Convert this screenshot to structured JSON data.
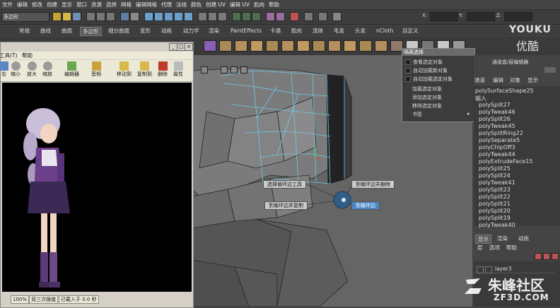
{
  "menubar": {
    "items": [
      "文件",
      "编辑",
      "修改",
      "创建",
      "显示",
      "窗口",
      "资源",
      "选择",
      "网格",
      "编辑网格",
      "代理",
      "法线",
      "颜色",
      "创建 UV",
      "编辑 UV",
      "肌肉",
      "帮助"
    ]
  },
  "statusline": {
    "mode": "多边形",
    "x_label": "X:",
    "y_label": "Y:",
    "z_label": "Z:"
  },
  "shelf": {
    "tabs": [
      "常规",
      "曲线",
      "曲面",
      "多边形",
      "细分曲面",
      "变形",
      "动画",
      "动力学",
      "渲染",
      "PaintEffects",
      "卡通",
      "肌肉",
      "流体",
      "毛发",
      "头发",
      "nCloth",
      "自定义"
    ],
    "active": "多边形"
  },
  "watermark": {
    "youku": "YOUKU",
    "youku_cn": "优酷",
    "site_cn": "朱峰社区",
    "site_en": "ZF3D.COM"
  },
  "leftwin": {
    "title": "工具(T)",
    "menu": [
      "工具(T)",
      "帮助"
    ],
    "tools": [
      "右",
      "缩小",
      "放大",
      "缩放",
      "编辑器",
      "音频",
      "移动到",
      "复制到",
      "删除",
      "属性"
    ],
    "status": [
      "100%",
      "双三次插值",
      "已载入于 0.0 秒"
    ]
  },
  "popup": {
    "title": "隔离选择",
    "items": [
      {
        "label": "查看选定对象",
        "checkbox": true
      },
      {
        "label": "自动加载新对象",
        "checkbox": true
      },
      {
        "label": "自动加载选定对象",
        "checkbox": true
      },
      {
        "label": "加载选定对象",
        "checkbox": false
      },
      {
        "label": "添加选定对象",
        "checkbox": false
      },
      {
        "label": "移除选定对象",
        "checkbox": false
      },
      {
        "label": "书签",
        "checkbox": false,
        "submenu": true
      }
    ]
  },
  "marking_menu": {
    "n": "选择循环边工具",
    "ne": "到循环边并删除",
    "sw": "到循环边并复制",
    "se": "到循环边"
  },
  "rightpanel": {
    "header": "通道盒/层编辑器",
    "tabs": [
      "通道",
      "编辑",
      "对象",
      "显示"
    ],
    "shape": "polySurfaceShape25",
    "inputs_label": "输入",
    "history": [
      "polySplit27",
      "polyTweak46",
      "polySplit26",
      "polyTweak45",
      "polySplitRing22",
      "polySeparate5",
      "polyChipOff3",
      "polyTweak44",
      "polyExtrudeFace15",
      "polySplit25",
      "polySplit24",
      "polyTweak41",
      "polySplit23",
      "polySplit22",
      "polySplit21",
      "polySplit20",
      "polySplit19",
      "polyTweak40"
    ],
    "layer_tabs": [
      "显示",
      "渲染",
      "动画"
    ],
    "layer_active": "显示",
    "layer_menu": [
      "层",
      "选项",
      "帮助"
    ],
    "layer_name": "layer3"
  }
}
